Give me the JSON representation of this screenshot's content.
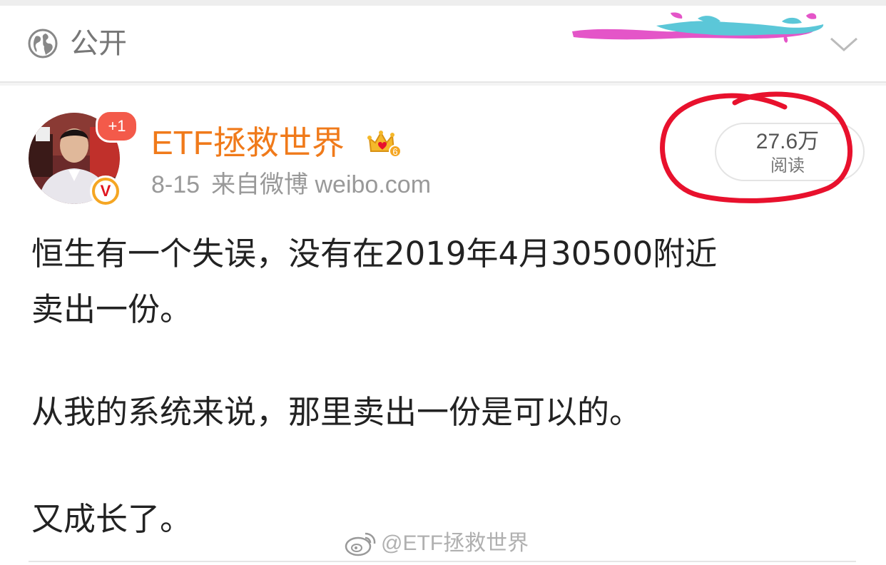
{
  "visibility": {
    "icon": "globe-icon",
    "label": "公开"
  },
  "post": {
    "author": "ETF拯救世界",
    "notification_badge": "+1",
    "verified_mark": "V",
    "member_icon": "crown-badge-icon",
    "member_level": "6",
    "date": "8-15",
    "source": "来自微博 weibo.com",
    "reads": {
      "count": "27.6万",
      "label": "阅读"
    },
    "body_lines": [
      "恒生有一个失误，没有在2019年4月30500附近",
      "卖出一份。",
      "从我的系统来说，那里卖出一份是可以的。",
      "又成长了。"
    ]
  },
  "watermark": {
    "text": "@ETF拯救世界"
  },
  "colors": {
    "author_name": "#f07a1a",
    "annotation_circle": "#e8112d",
    "body_text": "#222222",
    "meta_text": "#999999"
  }
}
